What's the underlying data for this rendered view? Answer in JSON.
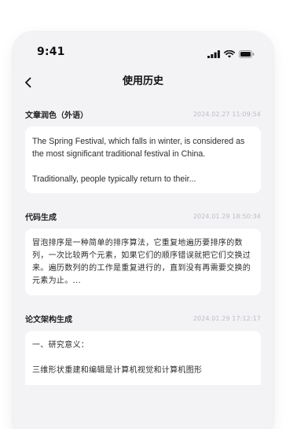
{
  "status_bar": {
    "time": "9:41",
    "icons": [
      "signal-icon",
      "wifi-icon",
      "battery-icon"
    ]
  },
  "nav": {
    "back_icon": "chevron-left-icon",
    "title": "使用历史"
  },
  "records": [
    {
      "type": "文章润色（外语）",
      "time": "2024.02.27 11:09:54",
      "paragraphs": [
        "The Spring Festival, which falls in winter, is considered as the most significant traditional festival in China.",
        "Traditionally, people typically return to their..."
      ]
    },
    {
      "type": "代码生成",
      "time": "2024.01.29 18:50:34",
      "paragraphs": [
        "冒泡排序是一种简单的排序算法，它重复地遍历要排序的数列，一次比较两个元素，如果它们的顺序错误就把它们交换过来。遍历数列的的工作是重复进行的，直到没有再需要交换的元素为止。..."
      ]
    },
    {
      "type": "论文架构生成",
      "time": "2024.01.29 17:12:17",
      "paragraphs": [
        "一、研究意义：",
        "三维形状重建和编辑是计算机视觉和计算机图形"
      ]
    }
  ],
  "colors": {
    "page_background": "#ffffff",
    "phone_background": "#f3f3f6",
    "card_background": "#ffffff",
    "title_text": "#111111",
    "body_text": "#2c2c2c",
    "timestamp_text": "#bcbcc4"
  }
}
